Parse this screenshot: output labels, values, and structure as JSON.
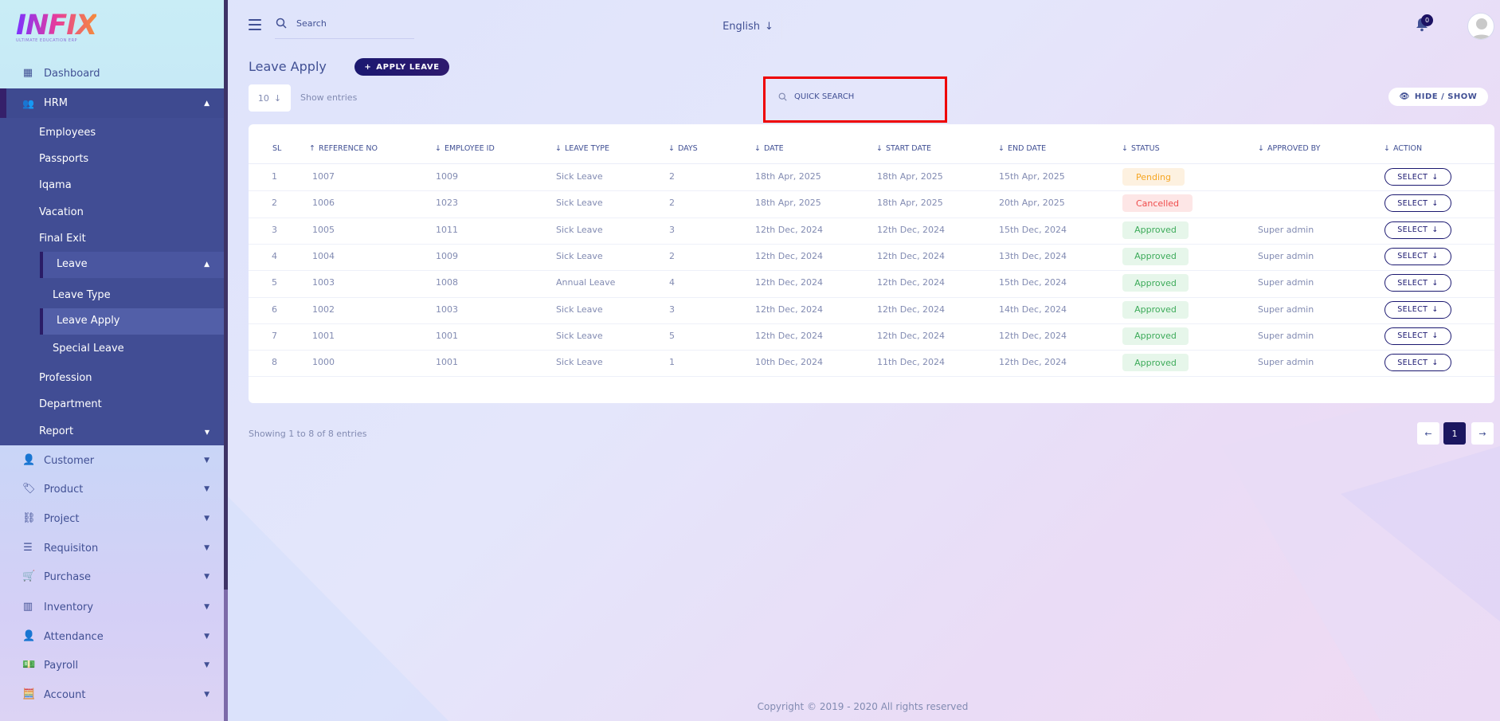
{
  "brand": {
    "logo": "INFIX",
    "tagline": "ULTIMATE EDUCATION ERP"
  },
  "sidebar": {
    "dashboard": "Dashboard",
    "hrm": "HRM",
    "hrm_items": [
      "Employees",
      "Passports",
      "Iqama",
      "Vacation",
      "Final Exit"
    ],
    "leave": "Leave",
    "leave_items": [
      "Leave Type",
      "Leave Apply",
      "Special Leave"
    ],
    "hrm_items_after": [
      "Profession",
      "Department"
    ],
    "report": "Report",
    "modules": [
      "Customer",
      "Product",
      "Project",
      "Requisiton",
      "Purchase",
      "Inventory",
      "Attendance",
      "Payroll",
      "Account"
    ]
  },
  "topbar": {
    "search_placeholder": "Search",
    "language": "English",
    "notification_count": "0"
  },
  "page": {
    "title": "Leave Apply",
    "apply_button": "APPLY LEAVE",
    "entries_value": "10",
    "show_entries": "Show entries",
    "quick_search": "QUICK SEARCH",
    "hide_show": "HIDE / SHOW"
  },
  "table": {
    "headers": [
      "SL",
      "REFERENCE NO",
      "EMPLOYEE ID",
      "LEAVE TYPE",
      "DAYS",
      "DATE",
      "START DATE",
      "END DATE",
      "STATUS",
      "APPROVED BY",
      "ACTION"
    ],
    "rows": [
      {
        "sl": "1",
        "ref": "1007",
        "emp": "1009",
        "type": "Sick Leave",
        "days": "2",
        "date": "18th Apr, 2025",
        "start": "18th Apr, 2025",
        "end": "15th Apr, 2025",
        "status": "Pending",
        "approved": "",
        "action": "SELECT"
      },
      {
        "sl": "2",
        "ref": "1006",
        "emp": "1023",
        "type": "Sick Leave",
        "days": "2",
        "date": "18th Apr, 2025",
        "start": "18th Apr, 2025",
        "end": "20th Apr, 2025",
        "status": "Cancelled",
        "approved": "",
        "action": "SELECT"
      },
      {
        "sl": "3",
        "ref": "1005",
        "emp": "1011",
        "type": "Sick Leave",
        "days": "3",
        "date": "12th Dec, 2024",
        "start": "12th Dec, 2024",
        "end": "15th Dec, 2024",
        "status": "Approved",
        "approved": "Super admin",
        "action": "SELECT"
      },
      {
        "sl": "4",
        "ref": "1004",
        "emp": "1009",
        "type": "Sick Leave",
        "days": "2",
        "date": "12th Dec, 2024",
        "start": "12th Dec, 2024",
        "end": "13th Dec, 2024",
        "status": "Approved",
        "approved": "Super admin",
        "action": "SELECT"
      },
      {
        "sl": "5",
        "ref": "1003",
        "emp": "1008",
        "type": "Annual Leave",
        "days": "4",
        "date": "12th Dec, 2024",
        "start": "12th Dec, 2024",
        "end": "15th Dec, 2024",
        "status": "Approved",
        "approved": "Super admin",
        "action": "SELECT"
      },
      {
        "sl": "6",
        "ref": "1002",
        "emp": "1003",
        "type": "Sick Leave",
        "days": "3",
        "date": "12th Dec, 2024",
        "start": "12th Dec, 2024",
        "end": "14th Dec, 2024",
        "status": "Approved",
        "approved": "Super admin",
        "action": "SELECT"
      },
      {
        "sl": "7",
        "ref": "1001",
        "emp": "1001",
        "type": "Sick Leave",
        "days": "5",
        "date": "12th Dec, 2024",
        "start": "12th Dec, 2024",
        "end": "12th Dec, 2024",
        "status": "Approved",
        "approved": "Super admin",
        "action": "SELECT"
      },
      {
        "sl": "8",
        "ref": "1000",
        "emp": "1001",
        "type": "Sick Leave",
        "days": "1",
        "date": "10th Dec, 2024",
        "start": "11th Dec, 2024",
        "end": "12th Dec, 2024",
        "status": "Approved",
        "approved": "Super admin",
        "action": "SELECT"
      }
    ]
  },
  "pagination": {
    "summary": "Showing 1 to 8 of 8 entries",
    "current": "1"
  },
  "footer": "Copyright © 2019 - 2020 All rights reserved",
  "colors": {
    "primary": "#415094",
    "accent": "#1b1870",
    "highlight": "#ee0000"
  }
}
